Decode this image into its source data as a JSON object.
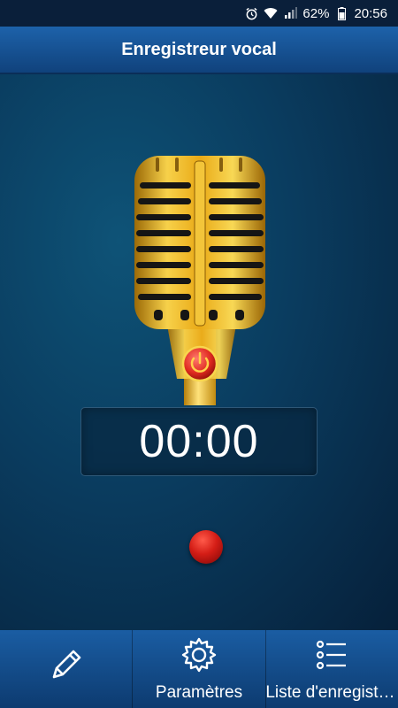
{
  "status_bar": {
    "battery_percent": "62%",
    "time": "20:56",
    "icons": [
      "alarm-icon",
      "wifi-icon",
      "signal-icon",
      "battery-icon"
    ]
  },
  "app_bar": {
    "title": "Enregistreur vocal"
  },
  "timer": {
    "value": "00:00"
  },
  "bottom_nav": {
    "items": [
      {
        "icon": "pencil-icon",
        "label": ""
      },
      {
        "icon": "gear-icon",
        "label": "Paramètres"
      },
      {
        "icon": "list-icon",
        "label": "Liste d'enregistrements"
      }
    ]
  },
  "colors": {
    "accent_blue": "#1d62aa",
    "mic_gold": "#e9b21e",
    "record_red": "#d41d16"
  }
}
